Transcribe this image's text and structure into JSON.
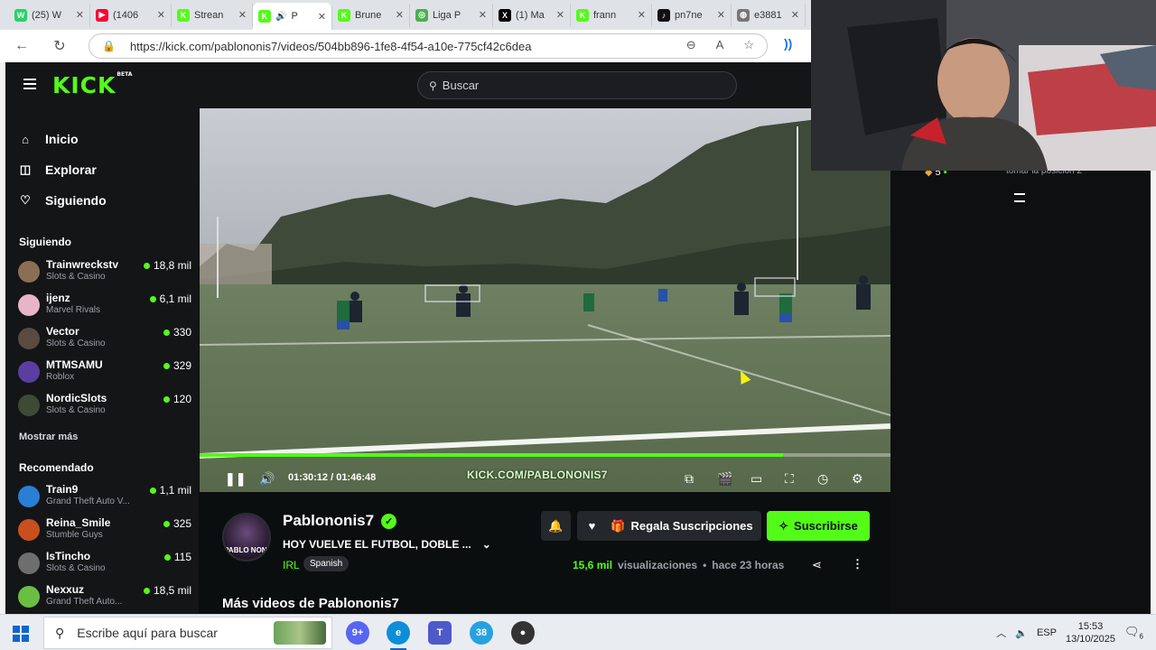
{
  "browser": {
    "tabs": [
      {
        "label": "(25) W",
        "fav_color": "#25d366",
        "fav_glyph": "W"
      },
      {
        "label": "(1406",
        "fav_color": "#ff0033",
        "fav_glyph": "▶"
      },
      {
        "label": "Strean",
        "fav_color": "#53fc18",
        "fav_glyph": "K"
      },
      {
        "label": "P",
        "fav_color": "#53fc18",
        "fav_glyph": "K",
        "active": true
      },
      {
        "label": "Brune",
        "fav_color": "#53fc18",
        "fav_glyph": "K"
      },
      {
        "label": "Liga P",
        "fav_color": "#4caf50",
        "fav_glyph": "◎"
      },
      {
        "label": "(1) Ma",
        "fav_color": "#000000",
        "fav_glyph": "X"
      },
      {
        "label": "frann",
        "fav_color": "#53fc18",
        "fav_glyph": "K"
      },
      {
        "label": "pn7ne",
        "fav_color": "#111111",
        "fav_glyph": "♪"
      },
      {
        "label": "e3881",
        "fav_color": "#777777",
        "fav_glyph": "◍"
      }
    ],
    "url": "https://kick.com/pablononis7/videos/504bb896-1fe8-4f54-a10e-775cf42c6dea"
  },
  "kick": {
    "logo": "KICK",
    "logo_badge": "BETA",
    "search_placeholder": "Buscar",
    "nav": [
      {
        "label": "Inicio",
        "icon": "home-icon"
      },
      {
        "label": "Explorar",
        "icon": "compass-icon"
      },
      {
        "label": "Siguiendo",
        "icon": "heart-icon"
      }
    ],
    "following_title": "Siguiendo",
    "following": [
      {
        "name": "Trainwreckstv",
        "category": "Slots & Casino",
        "viewers": "18,8 mil",
        "color": "#8a6f55"
      },
      {
        "name": "ijenz",
        "category": "Marvel Rivals",
        "viewers": "6,1 mil",
        "color": "#e8b4c8"
      },
      {
        "name": "Vector",
        "category": "Slots & Casino",
        "viewers": "330",
        "color": "#5b4a3f"
      },
      {
        "name": "MTMSAMU",
        "category": "Roblox",
        "viewers": "329",
        "color": "#5a3fa0"
      },
      {
        "name": "NordicSlots",
        "category": "Slots & Casino",
        "viewers": "120",
        "color": "#3d4a36"
      }
    ],
    "show_more": "Mostrar más",
    "recommended_title": "Recomendado",
    "recommended": [
      {
        "name": "Train9",
        "category": "Grand Theft Auto V...",
        "viewers": "1,1 mil",
        "color": "#2a7fd4"
      },
      {
        "name": "Reina_Smile",
        "category": "Stumble Guys",
        "viewers": "325",
        "color": "#c8501e"
      },
      {
        "name": "IsTincho",
        "category": "Slots & Casino",
        "viewers": "115",
        "color": "#6e6e6e"
      },
      {
        "name": "Nexxuz",
        "category": "Grand Theft Auto...",
        "viewers": "18,5 mil",
        "color": "#6abf43"
      }
    ],
    "player": {
      "current_time": "01:30:12",
      "duration": "01:46:48",
      "time_display": "01:30:12 / 01:46:48",
      "progress": 0.844,
      "watermark": "KICK.COM/PABLONONIS7"
    },
    "channel": {
      "name": "Pablononis7",
      "avatar_text": "PABLO NONI",
      "title": "HOY VUELVE EL FUTBOL, DOBLE ...",
      "category": "IRL",
      "language": "Spanish",
      "gift_label": "Regala Suscripciones",
      "subscribe_label": "Suscribirse",
      "views": "15,6 mil",
      "views_suffix": "visualizaciones",
      "separator": "•",
      "age": "hace 23 horas",
      "more_videos": "Más videos de Pablononis7"
    },
    "chat": {
      "badge_count": "5",
      "snippet": "tomar la posición 2"
    }
  },
  "taskbar": {
    "search_placeholder": "Escribe aquí para buscar",
    "language": "ESP",
    "time": "15:53",
    "date": "13/10/2025",
    "notifications": "6",
    "telegram_badge": "38",
    "discord_badge": "9+"
  },
  "colors": {
    "kick_green": "#53fc18",
    "kick_bg": "#0b0e0f",
    "panel": "#141517"
  }
}
